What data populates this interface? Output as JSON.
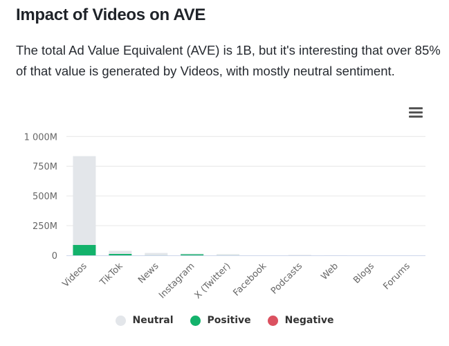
{
  "header": {
    "title": "Impact of Videos on AVE",
    "description": "The total Ad Value Equivalent (AVE) is 1B, but it's interesting that over 85% of that value is generated by Videos, with mostly neutral sentiment."
  },
  "menu": {
    "icon": "hamburger-menu-icon"
  },
  "chart_data": {
    "type": "bar",
    "stacked": true,
    "title": "",
    "xlabel": "",
    "ylabel": "",
    "categories": [
      "Videos",
      "TikTok",
      "News",
      "Instagram",
      "X (Twitter)",
      "Facebook",
      "Podcasts",
      "Web",
      "Blogs",
      "Forums"
    ],
    "series": [
      {
        "name": "Neutral",
        "color": "#e3e6ea",
        "values": [
          747,
          26,
          19,
          1,
          9,
          0,
          4,
          1,
          0,
          0
        ]
      },
      {
        "name": "Positive",
        "color": "#13b26b",
        "values": [
          88,
          12,
          1,
          12,
          1,
          0,
          0,
          0,
          0,
          0
        ]
      },
      {
        "name": "Negative",
        "color": "#db5160",
        "values": [
          0,
          0,
          0,
          0,
          0,
          0,
          0,
          0,
          0,
          0
        ]
      }
    ],
    "ylim": [
      0,
      1000
    ],
    "yunit": "M",
    "yticks": [
      0,
      250,
      500,
      750,
      1000
    ],
    "ytick_labels": [
      "0",
      "250M",
      "500M",
      "750M",
      "1 000M"
    ],
    "grid": true,
    "legend_position": "bottom-center"
  }
}
